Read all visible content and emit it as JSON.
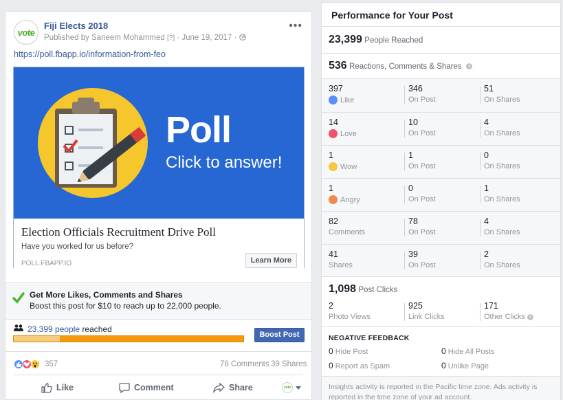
{
  "post": {
    "page_name": "Fiji Elects 2018",
    "avatar_text": "vote",
    "published_by": "Published by Saneem Mohammed",
    "help_mark": "[?]",
    "date": "June 19, 2017",
    "link_url": "https://poll.fbapp.io/information-from-feo",
    "image": {
      "title": "Poll",
      "subtitle": "Click to answer!"
    },
    "link_title": "Election Officials Recruitment Drive Poll",
    "link_description": "Have you worked for us before?",
    "link_domain": "POLL.FBAPP.IO",
    "learn_more_label": "Learn More",
    "promo": {
      "title": "Get More Likes, Comments and Shares",
      "text": "Boost this post for $10 to reach up to 22,000 people."
    },
    "reach": {
      "count": "23,399",
      "people_word": "people",
      "reached_word": "reached",
      "organic_fraction": 0.2
    },
    "boost_label": "Boost Post",
    "reactions_count": "357",
    "comments_count": "78 Comments",
    "shares_count": "39 Shares",
    "actions": {
      "like": "Like",
      "comment": "Comment",
      "share": "Share"
    },
    "colors": {
      "link": "#365899",
      "accent": "#4267b2",
      "progress": "#f59a0f"
    }
  },
  "insights": {
    "title": "Performance for Your Post",
    "people_reached": {
      "value": "23,399",
      "label": "People Reached"
    },
    "engagement": {
      "value": "536",
      "label": "Reactions, Comments & Shares"
    },
    "rows": [
      {
        "total": "397",
        "label": "Like",
        "on_post": "346",
        "on_shares": "51"
      },
      {
        "total": "14",
        "label": "Love",
        "on_post": "10",
        "on_shares": "4"
      },
      {
        "total": "1",
        "label": "Wow",
        "on_post": "1",
        "on_shares": "0"
      },
      {
        "total": "1",
        "label": "Angry",
        "on_post": "0",
        "on_shares": "1"
      },
      {
        "total": "82",
        "label": "Comments",
        "on_post": "78",
        "on_shares": "4"
      },
      {
        "total": "41",
        "label": "Shares",
        "on_post": "39",
        "on_shares": "2"
      }
    ],
    "on_post_label": "On Post",
    "on_shares_label": "On Shares",
    "post_clicks": {
      "value": "1,098",
      "label": "Post Clicks"
    },
    "clicks": [
      {
        "value": "2",
        "label": "Photo Views"
      },
      {
        "value": "925",
        "label": "Link Clicks"
      },
      {
        "value": "171",
        "label": "Other Clicks"
      }
    ],
    "negative_feedback": {
      "title": "NEGATIVE FEEDBACK",
      "hide_post": {
        "value": "0",
        "label": "Hide Post"
      },
      "hide_all_posts": {
        "value": "0",
        "label": "Hide All Posts"
      },
      "report_spam": {
        "value": "0",
        "label": "Report as Spam"
      },
      "unlike_page": {
        "value": "0",
        "label": "Unlike Page"
      }
    },
    "footnote": "Insights activity is reported in the Pacific time zone. Ads activity is reported in the time zone of your ad account."
  }
}
